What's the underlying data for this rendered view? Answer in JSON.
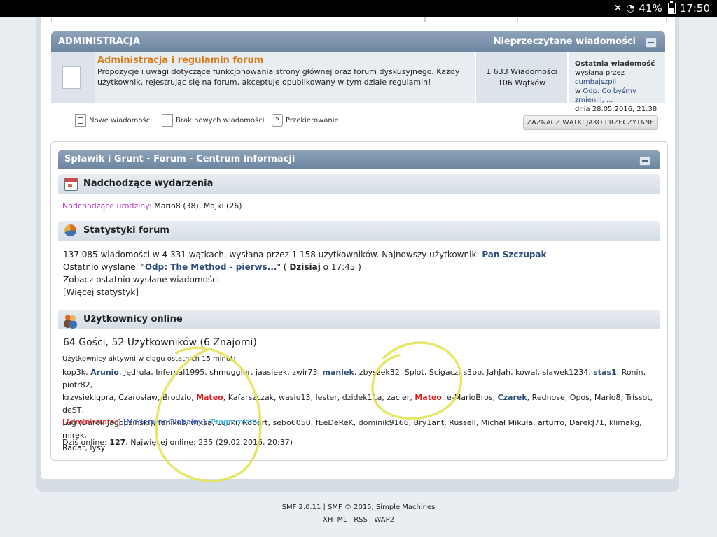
{
  "statusbar": {
    "battery": "41%",
    "time": "17:50",
    "icons": [
      "mute-icon",
      "wifi-icon",
      "battery-icon"
    ]
  },
  "category": {
    "name": "ADMINISTRACJA",
    "unread_link": "Nieprzeczytane wiadomości"
  },
  "board": {
    "title": "Administracja i regulamin forum",
    "description": "Propozycje i uwagi dotyczące funkcjonowania strony głównej oraz forum dyskusyjnego. Każdy użytkownik, rejestrując się na forum, akceptuje opublikowany w tym dziale regulamin!",
    "posts": "1 633 Wiadomości",
    "topics": "106 Wątków",
    "last_label": "Ostatnia wiadomość",
    "last_by": "wysłana przez",
    "last_user": "cumbajszpil",
    "last_in": "w",
    "last_topic": "Odp: Co byśmy zmienili, ...",
    "last_date": "dnia 28.05.2016, 21:38"
  },
  "legend": {
    "new": "Nowe wiadomości",
    "no_new": "Brak nowych wiadomości",
    "redirect": "Przekierowanie"
  },
  "mark_read": "ZAZNACZ WĄTKI JAKO PRZECZYTANE",
  "info_center": {
    "title": "Spławik i Grunt - Forum - Centrum informacji",
    "events": {
      "title": "Nadchodzące wydarzenia",
      "birthdays_label": "Nadchodzące urodziny:",
      "birthdays": "Mario8 (38), Majki (26)"
    },
    "stats": {
      "title": "Statystyki forum",
      "line1": "137 085 wiadomości w 4 331 wątkach, wysłana przez 1 158 użytkowników. Najnowszy użytkownik:",
      "newest": "Pan Szczupak",
      "line2_prefix": "Ostatnio wysłane: \"",
      "line2_topic": "Odp: The Method - pierws...",
      "line2_mid": "\" ( ",
      "line2_when": "Dzisiaj",
      "line2_suffix": " o 17:45 )",
      "line3": "Zobacz ostatnio wysłane wiadomości",
      "line4": "[Więcej statystyk]"
    },
    "online": {
      "title": "Użytkownicy online",
      "summary": "64 Gości, 52 Użytkowników (6 Znajomi)",
      "active_label": "Użytkownicy aktywni w ciągu ostatnich 15 minut:",
      "users_line1": [
        {
          "name": "kop3k",
          "style": ""
        },
        {
          "name": "Arunio",
          "style": "b"
        },
        {
          "name": "Jędrula",
          "style": ""
        },
        {
          "name": "Infernal1995",
          "style": ""
        },
        {
          "name": "shmuggler",
          "style": ""
        },
        {
          "name": "jaasieek",
          "style": ""
        },
        {
          "name": "zwir73",
          "style": ""
        },
        {
          "name": "maniek",
          "style": "b"
        },
        {
          "name": "zbyszek32",
          "style": ""
        },
        {
          "name": "Splot",
          "style": ""
        },
        {
          "name": "Ścigacz",
          "style": ""
        },
        {
          "name": "s3pp",
          "style": ""
        },
        {
          "name": "JahJah",
          "style": ""
        },
        {
          "name": "kowal",
          "style": ""
        },
        {
          "name": "slawek1234",
          "style": ""
        },
        {
          "name": "stas1",
          "style": "b"
        },
        {
          "name": "Ronin",
          "style": ""
        },
        {
          "name": "piotr82",
          "style": ""
        }
      ],
      "users_line2": [
        {
          "name": "krzysiekjgora",
          "style": ""
        },
        {
          "name": "Czarosław",
          "style": ""
        },
        {
          "name": "Brodzio",
          "style": ""
        },
        {
          "name": "Mateo",
          "style": "r"
        },
        {
          "name": "Kafarszczak",
          "style": ""
        },
        {
          "name": "wasiu13",
          "style": ""
        },
        {
          "name": "lester",
          "style": ""
        },
        {
          "name": "dzidek11a",
          "style": ""
        },
        {
          "name": "zacier",
          "style": ""
        },
        {
          "name": "Mateo",
          "style": "r"
        },
        {
          "name": "e-MarioBros",
          "style": ""
        },
        {
          "name": "Czarek",
          "style": "b"
        },
        {
          "name": "Rednose",
          "style": ""
        },
        {
          "name": "Opos",
          "style": ""
        },
        {
          "name": "Mario8",
          "style": ""
        },
        {
          "name": "Trissot",
          "style": ""
        },
        {
          "name": "deST",
          "style": ""
        }
      ],
      "users_line3": [
        {
          "name": "Lug (Darek Jagodziński)",
          "style": ""
        },
        {
          "name": "fenikks",
          "style": ""
        },
        {
          "name": "wiksa",
          "style": ""
        },
        {
          "name": "Luuki",
          "style": ""
        },
        {
          "name": "Robert",
          "style": ""
        },
        {
          "name": "sebo6050",
          "style": ""
        },
        {
          "name": "fEeDeReK",
          "style": ""
        },
        {
          "name": "dominik9166",
          "style": ""
        },
        {
          "name": "Bry1ant",
          "style": ""
        },
        {
          "name": "Russell",
          "style": ""
        },
        {
          "name": "Michał Mikuła",
          "style": ""
        },
        {
          "name": "arturro",
          "style": ""
        },
        {
          "name": "DarekJ71",
          "style": ""
        },
        {
          "name": "klimakg",
          "style": ""
        },
        {
          "name": "mirek",
          "style": ""
        }
      ],
      "users_line4": [
        {
          "name": "Radar",
          "style": ""
        },
        {
          "name": "lysy",
          "style": ""
        }
      ],
      "groups": {
        "admin": "Administrator",
        "mod": "Moderator Globalny",
        "prog": "Programista"
      },
      "today_label": "Dziś online:",
      "today_count": "127",
      "record": "Najwięcej online: 235 (29.02.2016, 20:37)"
    }
  },
  "footer": {
    "line1": "SMF 2.0.11 | SMF © 2015, Simple Machines",
    "links": [
      "XHTML",
      "RSS",
      "WAP2"
    ]
  }
}
